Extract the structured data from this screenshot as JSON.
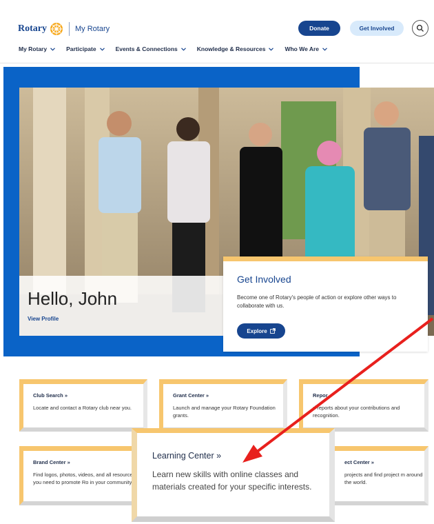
{
  "header": {
    "brand": "Rotary",
    "brand_sub": "My Rotary",
    "donate_label": "Donate",
    "get_involved_label": "Get Involved"
  },
  "nav": {
    "items": [
      {
        "label": "My Rotary"
      },
      {
        "label": "Participate"
      },
      {
        "label": "Events & Connections"
      },
      {
        "label": "Knowledge & Resources"
      },
      {
        "label": "Who We Are"
      }
    ]
  },
  "hero": {
    "greeting": "Hello, John",
    "profile_link": "View Profile"
  },
  "involve": {
    "title": "Get Involved",
    "text": "Become one of Rotary's people of action or explore other ways to collaborate with us.",
    "button": "Explore"
  },
  "cards": [
    {
      "title": "Club Search »",
      "text": "Locate and contact a Rotary club near you."
    },
    {
      "title": "Grant Center »",
      "text": "Launch and manage your Rotary Foundation grants."
    },
    {
      "title": "Repor",
      "text": "d reports about your contributions and recognition."
    },
    {
      "title": "Brand Center »",
      "text": "Find logos, photos, videos, and all resources you need to promote Ro in your community."
    },
    {
      "title": "ect Center »",
      "text": "projects and find project m around the world."
    }
  ],
  "learning": {
    "title": "Learning Center »",
    "text": "Learn new skills with online classes and materials created for your specific interests."
  },
  "colors": {
    "rotary_blue": "#17458f",
    "hero_blue": "#0a63c7",
    "gold": "#f7c66e",
    "annotation_arrow": "#e8201d"
  }
}
